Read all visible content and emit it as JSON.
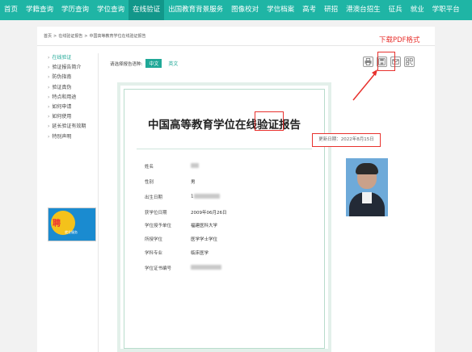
{
  "topnav": {
    "items": [
      "首页",
      "学籍查询",
      "学历查询",
      "学位查询",
      "在线验证",
      "出国教育背景服务",
      "图像校对",
      "学信档案",
      "高考",
      "研招",
      "港澳台招生",
      "征兵",
      "就业",
      "学职平台"
    ],
    "active_index": 4
  },
  "breadcrumb": [
    "首页",
    "在线验证报告",
    "中国高等教育学位在线验证报告"
  ],
  "sidebar": {
    "items": [
      "在线验证",
      "验证报告简介",
      "防伪指南",
      "验证真伪",
      "特点和用途",
      "如何申请",
      "如何使用",
      "延长验证有效期",
      "特别声明"
    ],
    "active_index": 0,
    "banner_text": "聘",
    "banner_sub": "就业服务"
  },
  "lang": {
    "label": "请选择报告语种:",
    "zh": "中文",
    "en": "英文"
  },
  "tools": [
    "print-icon",
    "pdf-download-icon",
    "mail-icon",
    "qrcode-icon"
  ],
  "annotation": {
    "label": "下载PDF格式"
  },
  "certificate": {
    "title": "中国高等教育学位在线验证报告",
    "update_date": "更新日期：2022年8月15日",
    "fields": [
      {
        "label": "姓名",
        "value": ""
      },
      {
        "label": "性别",
        "value": "男"
      },
      {
        "label": "出生日期",
        "value": "1"
      },
      {
        "label": "获学位日期",
        "value": "2009年06月26日"
      },
      {
        "label": "学位授予单位",
        "value": "福建医科大学"
      },
      {
        "label": "所授学位",
        "value": "医学学士学位"
      },
      {
        "label": "学科专业",
        "value": "临床医学"
      },
      {
        "label": "学位证书编号",
        "value": ""
      }
    ]
  },
  "colors": {
    "brand": "#1fb5a5",
    "annotation": "#e8322e"
  }
}
